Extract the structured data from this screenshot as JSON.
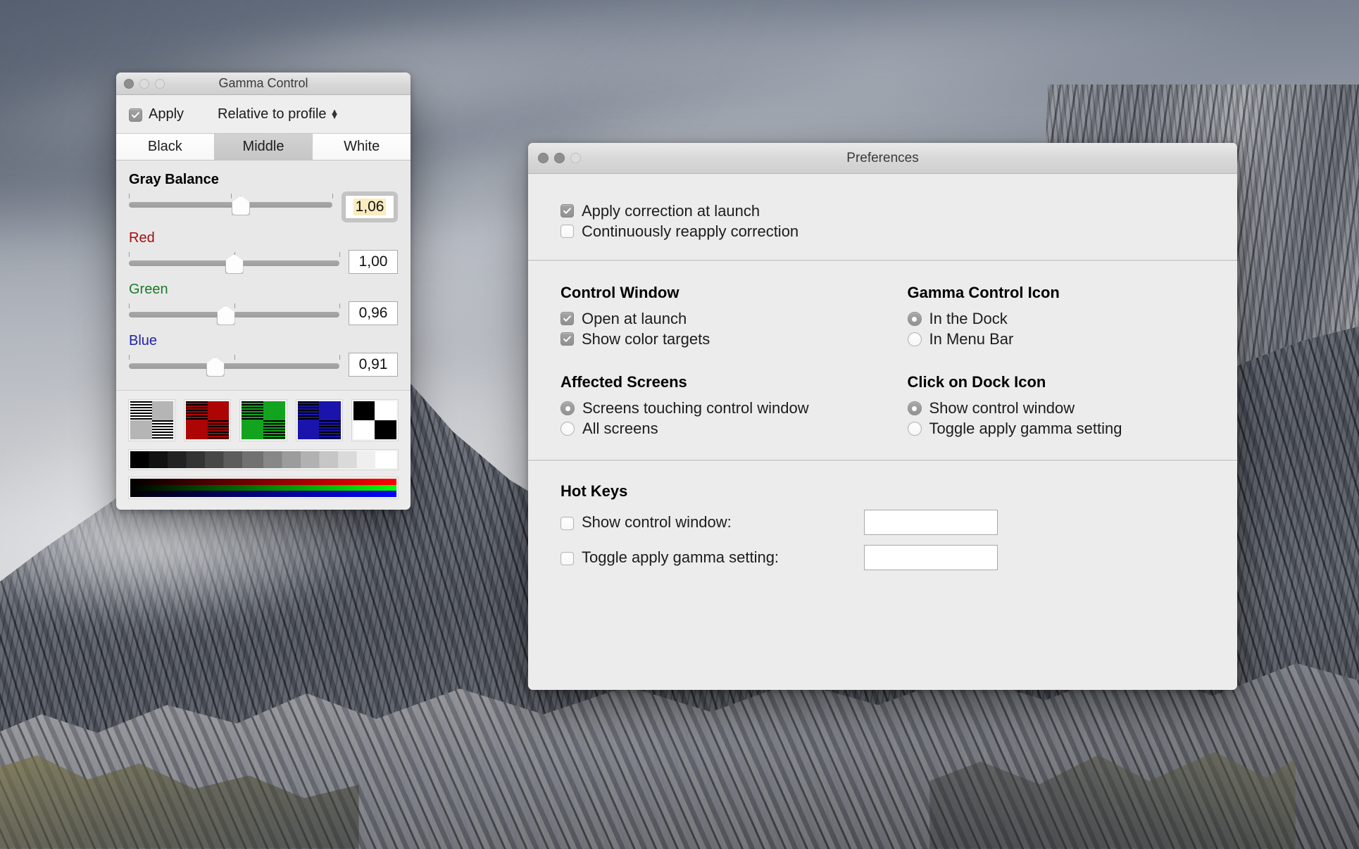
{
  "gamma_window": {
    "title": "Gamma Control",
    "apply_label": "Apply",
    "apply_checked": true,
    "mode_popup": "Relative to profile",
    "segments": [
      {
        "label": "Black",
        "selected": false
      },
      {
        "label": "Middle",
        "selected": true
      },
      {
        "label": "White",
        "selected": false
      }
    ],
    "sliders": [
      {
        "label": "Gray Balance",
        "value": "1,06",
        "color": "#000000",
        "bold": true,
        "position_pct": 50,
        "focused": true
      },
      {
        "label": "Red",
        "value": "1,00",
        "color": "#a01010",
        "bold": false,
        "position_pct": 48,
        "focused": false
      },
      {
        "label": "Green",
        "value": "0,96",
        "color": "#1a7a26",
        "bold": false,
        "position_pct": 44,
        "focused": false
      },
      {
        "label": "Blue",
        "value": "0,91",
        "color": "#2222aa",
        "bold": false,
        "position_pct": 40,
        "focused": false
      }
    ],
    "color_targets": [
      {
        "name": "gray-target",
        "color": "#b5b5b5"
      },
      {
        "name": "red-target",
        "color": "#ad0505"
      },
      {
        "name": "green-target",
        "color": "#13a41f"
      },
      {
        "name": "blue-target",
        "color": "#1a14ad"
      },
      {
        "name": "bw-target",
        "color": "#000000"
      }
    ],
    "traffic_lights": [
      "close",
      "minimize",
      "zoom"
    ]
  },
  "prefs_window": {
    "title": "Preferences",
    "traffic_lights": [
      "close",
      "minimize",
      "zoom"
    ],
    "top_options": [
      {
        "label": "Apply correction at launch",
        "checked": true
      },
      {
        "label": "Continuously reapply correction",
        "checked": false
      }
    ],
    "groups": {
      "control_window": {
        "heading": "Control Window",
        "options": [
          {
            "label": "Open at launch",
            "checked": true
          },
          {
            "label": "Show color targets",
            "checked": true
          }
        ]
      },
      "gamma_control_icon": {
        "heading": "Gamma Control Icon",
        "options": [
          {
            "label": "In the Dock",
            "selected": true
          },
          {
            "label": "In Menu Bar",
            "selected": false
          }
        ]
      },
      "affected_screens": {
        "heading": "Affected Screens",
        "options": [
          {
            "label": "Screens touching control window",
            "selected": true
          },
          {
            "label": "All screens",
            "selected": false
          }
        ]
      },
      "click_on_dock_icon": {
        "heading": "Click on Dock Icon",
        "options": [
          {
            "label": "Show control window",
            "selected": true
          },
          {
            "label": "Toggle apply gamma setting",
            "selected": false
          }
        ]
      },
      "hot_keys": {
        "heading": "Hot Keys",
        "rows": [
          {
            "label": "Show control window:",
            "checked": false,
            "value": "",
            "placeholder": ""
          },
          {
            "label": "Toggle apply gamma setting:",
            "checked": false,
            "value": "",
            "placeholder": ""
          }
        ]
      }
    }
  },
  "desktop": {
    "wallpaper_name": "dolomite-mountains-overcast"
  }
}
